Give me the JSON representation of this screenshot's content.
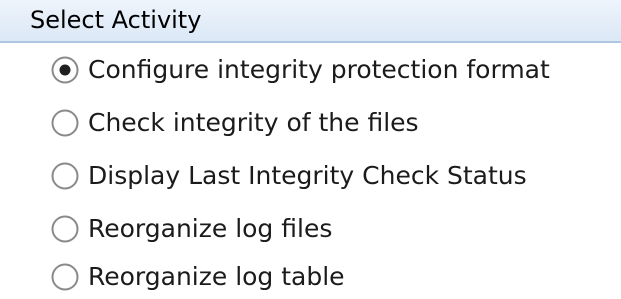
{
  "group": {
    "title": "Select Activity"
  },
  "options": [
    {
      "label": "Configure integrity protection format",
      "selected": true
    },
    {
      "label": "Check integrity of the files",
      "selected": false
    },
    {
      "label": "Display Last Integrity Check Status",
      "selected": false
    },
    {
      "label": "Reorganize log files",
      "selected": false
    },
    {
      "label": "Reorganize log table",
      "selected": false
    }
  ],
  "icons": {
    "radio_selected": "radio-selected-icon",
    "radio_unselected": "radio-unselected-icon"
  },
  "colors": {
    "header_bg": "#dbe8f6",
    "header_border": "#aec6e0",
    "radio_ring": "#8a8a8a",
    "radio_dot": "#1f1f1f"
  }
}
